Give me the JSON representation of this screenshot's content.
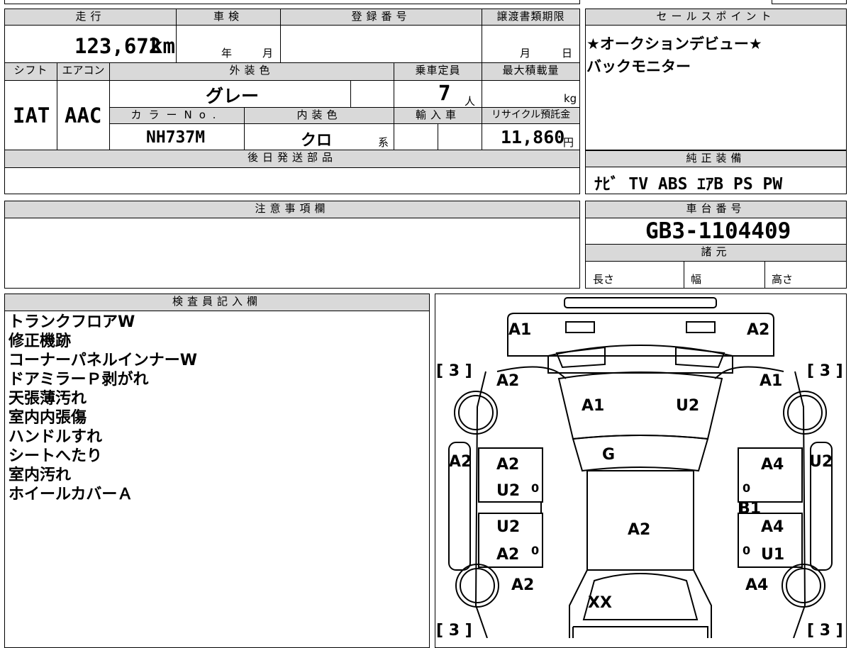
{
  "mileage": {
    "header": "走行",
    "value": "123,672",
    "unit": "km"
  },
  "inspection": {
    "header": "車検",
    "year": "年",
    "month": "月"
  },
  "registration": {
    "header": "登録番号"
  },
  "transfer": {
    "header": "譲渡書類期限",
    "month": "月",
    "day": "日"
  },
  "sales_points": {
    "header": "セールスポイント",
    "lines": [
      "★オークションデビュー★",
      "バックモニター"
    ]
  },
  "shift": {
    "header": "シフト",
    "value": "IAT"
  },
  "aircon": {
    "header": "エアコン",
    "value": "AAC"
  },
  "exterior_color": {
    "header": "外装色",
    "value": "グレー"
  },
  "capacity": {
    "header": "乗車定員",
    "value": "7",
    "unit": "人"
  },
  "max_load": {
    "header": "最大積載量",
    "unit": "kg"
  },
  "color_no": {
    "header": "カラーNo.",
    "value": "NH737M"
  },
  "interior_color": {
    "header": "内装色",
    "value": "クロ",
    "suffix": "系"
  },
  "import": {
    "header": "輸入車"
  },
  "recycle": {
    "header": "リサイクル預託金",
    "value": "11,860",
    "unit": "円"
  },
  "later_parts": {
    "header": "後日発送部品"
  },
  "genuine_equipment": {
    "header": "純正装備",
    "value": "ﾅﾋﾞ TV ABS ｴｱB PS PW"
  },
  "notes": {
    "header": "注意事項欄"
  },
  "chassis": {
    "header": "車台番号",
    "value": "GB3-1104409"
  },
  "specs": {
    "header": "諸元",
    "length": "長さ",
    "width": "幅",
    "height": "高さ"
  },
  "inspector": {
    "header": "検査員記入欄",
    "items": [
      "トランクフロアW",
      "修正機跡",
      "コーナーパネルインナーW",
      "ドアミラーＰ剥がれ",
      "天張薄汚れ",
      "室内内張傷",
      "ハンドルすれ",
      "シートへたり",
      "室内汚れ",
      "ホイールカバーＡ"
    ]
  },
  "diagram": {
    "tire_tl": "[ 3 ]",
    "tire_tr": "[ 3 ]",
    "tire_bl": "[ 3 ]",
    "tire_br": "[ 3 ]",
    "rear_left": "A1",
    "rear_right": "A2",
    "quarter_left": "A2",
    "quarter_right": "A1",
    "roof_left": "A1",
    "roof_right": "U2",
    "glass": "G",
    "side_left": "A2",
    "side_right": "U2",
    "rear_door_left_top": "A2",
    "rear_door_left_bottom": "U2",
    "rear_door_right_top": "A4",
    "rear_door_right_mid": "B1",
    "front_door_left_top": "U2",
    "front_door_left_bottom": "A2",
    "front_door_right_top": "A4",
    "front_door_right_bottom": "U1",
    "center": "A2",
    "fender_left": "A2",
    "fender_right": "A4",
    "hood": "XX",
    "zero": "0"
  }
}
